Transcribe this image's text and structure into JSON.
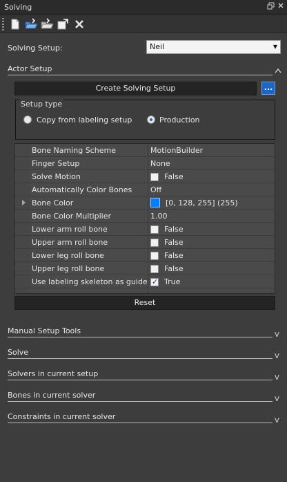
{
  "window": {
    "title": "Solving"
  },
  "colors": {
    "panel_bg": "#3d3d3d",
    "title_bg": "#2b2b2b",
    "accent_blue": "#1e66c4",
    "bone_color_swatch": "#0080ff"
  },
  "toolbar": {
    "tools": [
      {
        "icon": "new-document-icon"
      },
      {
        "icon": "open-folder-icon"
      },
      {
        "icon": "save-folder-icon"
      },
      {
        "icon": "export-icon"
      },
      {
        "icon": "delete-x-icon"
      }
    ]
  },
  "solving_setup": {
    "label": "Solving Setup:",
    "value": "Neil"
  },
  "actor_setup": {
    "title": "Actor Setup",
    "create_button": "Create Solving Setup",
    "browse_button": "...",
    "setup_type": {
      "legend": "Setup type",
      "options": [
        {
          "label": "Copy from labeling setup",
          "selected": false
        },
        {
          "label": "Production",
          "selected": true
        }
      ]
    },
    "properties": [
      {
        "name": "Bone Naming Scheme",
        "value": "MotionBuilder",
        "kind": "text"
      },
      {
        "name": "Finger Setup",
        "value": "None",
        "kind": "text"
      },
      {
        "name": "Solve Motion",
        "value": "False",
        "kind": "check",
        "checked": false
      },
      {
        "name": "Automatically Color Bones",
        "value": "Off",
        "kind": "text"
      },
      {
        "name": "Bone Color",
        "value": "[0, 128, 255] (255)",
        "kind": "color",
        "expandable": true
      },
      {
        "name": "Bone Color Multiplier",
        "value": "1.00",
        "kind": "text"
      },
      {
        "name": "Lower arm roll bone",
        "value": "False",
        "kind": "check",
        "checked": false
      },
      {
        "name": "Upper arm roll bone",
        "value": "False",
        "kind": "check",
        "checked": false
      },
      {
        "name": "Lower leg roll bone",
        "value": "False",
        "kind": "check",
        "checked": false
      },
      {
        "name": "Upper leg roll bone",
        "value": "False",
        "kind": "check",
        "checked": false
      },
      {
        "name": "Use labeling skeleton as guide",
        "value": "True",
        "kind": "check",
        "checked": true
      }
    ],
    "reset_button": "Reset"
  },
  "sections": [
    {
      "title": "Manual Setup Tools",
      "chevron": "V"
    },
    {
      "title": "Solve",
      "chevron": "V"
    },
    {
      "title": "Solvers in current setup",
      "chevron": "V"
    },
    {
      "title": "Bones in current solver",
      "chevron": "V"
    },
    {
      "title": "Constraints in current solver",
      "chevron": "V"
    }
  ],
  "actor_setup_chevron": "^"
}
